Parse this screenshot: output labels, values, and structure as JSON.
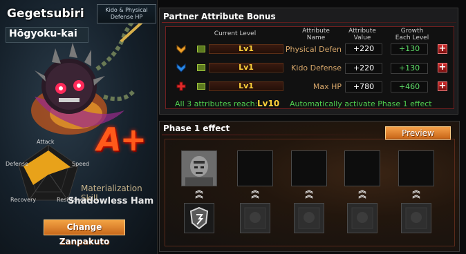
{
  "character": {
    "name": "Gegetsubiri",
    "group": "Hōgyoku-kai",
    "tag_line1": "Kido & Physical",
    "tag_line2": "Defense HP",
    "grade": "A+"
  },
  "radar": {
    "attack": "Attack",
    "defense": "Defense",
    "speed": "Speed",
    "recovery": "Recovery",
    "resistance": "Resistance"
  },
  "materialization": {
    "label": "Materialization Skill",
    "skill_name": "Shadowless Hamm"
  },
  "change_button": "Change Zanpakuto",
  "partner_bonus": {
    "title": "Partner Attribute Bonus",
    "headers": {
      "current_level": "Current Level",
      "attribute_name_1": "Attribute",
      "attribute_name_2": "Name",
      "attribute_value_1": "Attribute",
      "attribute_value_2": "Value",
      "growth_1": "Growth",
      "growth_2": "Each Level"
    },
    "rows": [
      {
        "level": "Lv1",
        "name": "Physical Defen",
        "value": "+220",
        "growth": "+130",
        "icon": "orange-chevron-icon"
      },
      {
        "level": "Lv1",
        "name": "Kido Defense",
        "value": "+220",
        "growth": "+130",
        "icon": "blue-chevron-icon"
      },
      {
        "level": "Lv1",
        "name": "Max HP",
        "value": "+780",
        "growth": "+460",
        "icon": "red-cross-icon"
      }
    ],
    "reach_text": "All 3 attributes reach:",
    "reach_level": "Lv10",
    "reach_effect": "Automatically activate Phase 1 effect"
  },
  "phase": {
    "title": "Phase 1 effect",
    "preview_button": "Preview",
    "slots_filled": 1,
    "slots_total": 5
  },
  "colors": {
    "accent_orange": "#e8862c",
    "level_yellow": "#ffd23a",
    "growth_green": "#5fe06a",
    "title_red": "#6e2020"
  }
}
